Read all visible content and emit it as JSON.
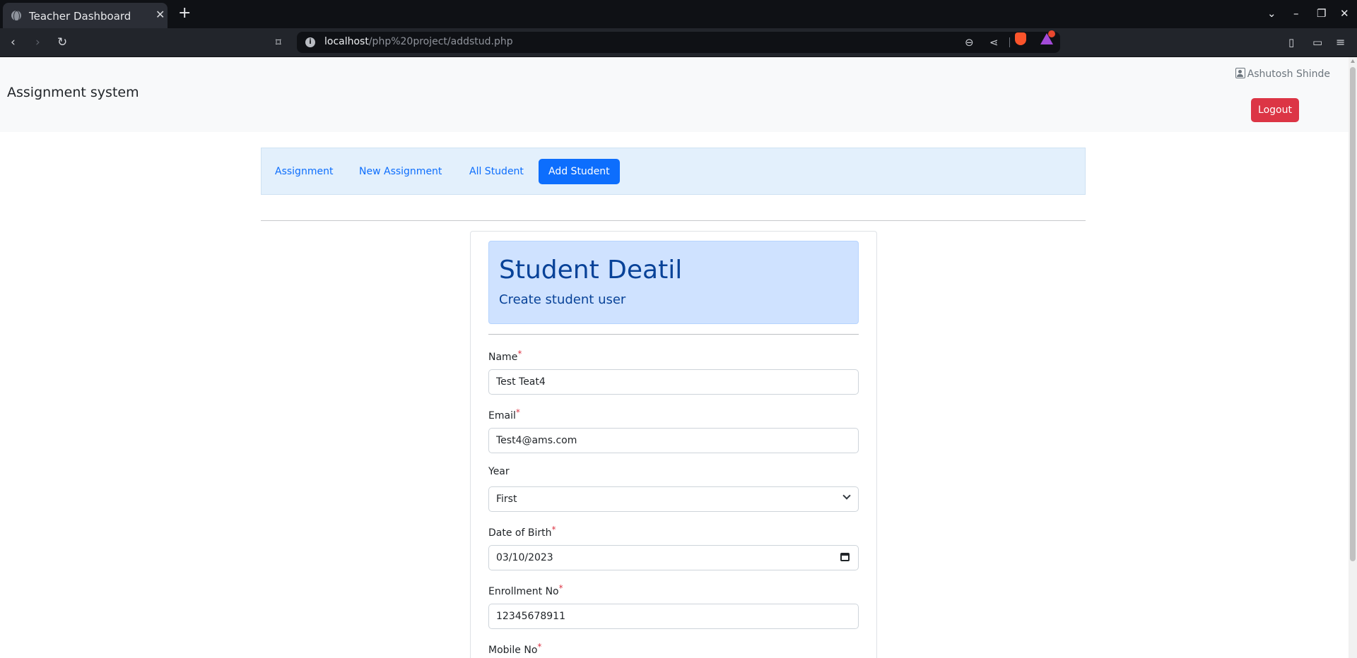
{
  "browser": {
    "tab_title": "Teacher Dashboard",
    "url_host": "localhost",
    "url_path": "/php%20project/addstud.php"
  },
  "header": {
    "brand": "Assignment system",
    "user_name": "Ashutosh Shinde",
    "logout_label": "Logout"
  },
  "nav": {
    "tabs": [
      {
        "label": "Assignment",
        "active": false
      },
      {
        "label": "New Assignment",
        "active": false
      },
      {
        "label": "All Student",
        "active": false
      },
      {
        "label": "Add Student",
        "active": true
      }
    ]
  },
  "form": {
    "title": "Student Deatil",
    "subtitle": "Create student user",
    "name": {
      "label": "Name",
      "required_mark": "*",
      "value": "Test Teat4"
    },
    "email": {
      "label": "Email",
      "required_mark": "*",
      "value": "Test4@ams.com"
    },
    "year": {
      "label": "Year",
      "value": "First"
    },
    "dob": {
      "label": "Date of Birth",
      "required_mark": "*",
      "value": "03/10/2023"
    },
    "enrollment": {
      "label": "Enrollment No",
      "required_mark": "*",
      "value": "12345678911"
    },
    "mobile": {
      "label": "Mobile No",
      "required_mark": "*"
    }
  },
  "icons": {
    "tab": "globe-icon",
    "nav": [
      "back-icon",
      "forward-icon",
      "reload-icon",
      "bookmark-icon"
    ],
    "url": [
      "info-icon",
      "zoom-out-icon",
      "share-icon",
      "brave-shields-icon",
      "brave-rewards-icon"
    ],
    "toolbar": [
      "sidebar-icon",
      "wallet-icon",
      "menu-icon"
    ],
    "user": "person-icon"
  }
}
